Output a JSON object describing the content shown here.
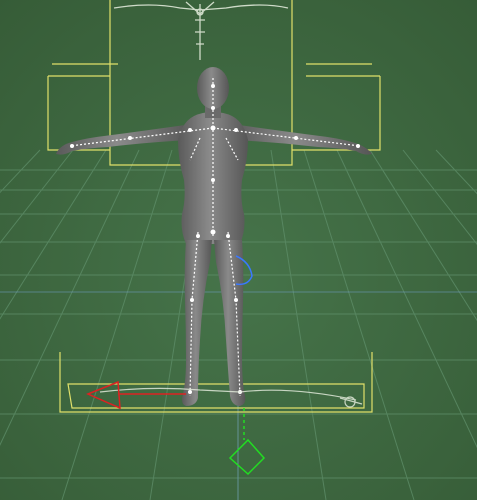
{
  "viewport": {
    "view": "3d-perspective",
    "background_color": "#3e6a3e",
    "grid_color": "#5f8f6a",
    "grid_accent_color": "#6f9dc3"
  },
  "scene": {
    "figure": {
      "kind": "humanoid-mesh",
      "pose": "t-pose",
      "color": "#707070",
      "skeleton_color": "#ffffff"
    },
    "bounding_boxes": {
      "color": "#e0e06a"
    },
    "gizmos": {
      "translate_gizmo_color": "#22dd22",
      "axis_x_color": "#dd2222",
      "rotation_gizmo_color": "#3a78ff"
    }
  }
}
